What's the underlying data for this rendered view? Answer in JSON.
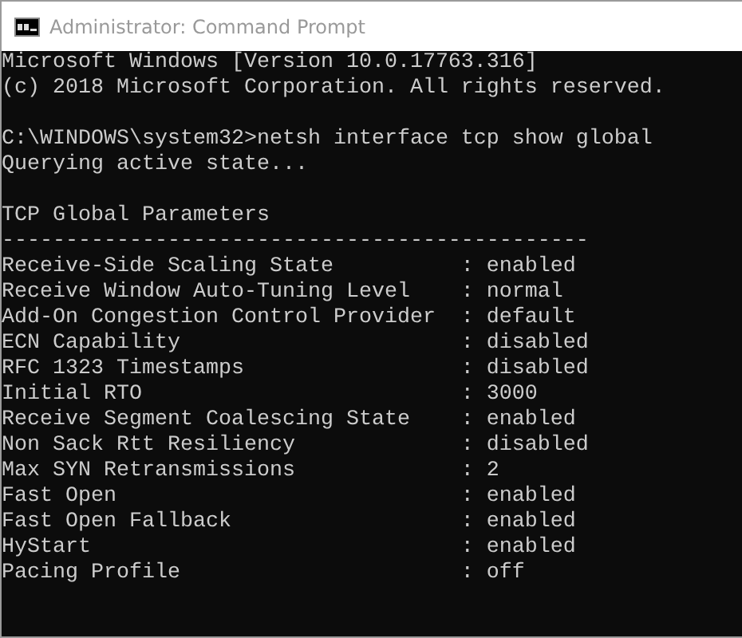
{
  "window": {
    "title": "Administrator: Command Prompt"
  },
  "console": {
    "banner": [
      "Microsoft Windows [Version 10.0.17763.316]",
      "(c) 2018 Microsoft Corporation. All rights reserved."
    ],
    "command": "C:\\WINDOWS\\system32>netsh interface tcp show global",
    "status": "Querying active state...",
    "section_title": "TCP Global Parameters",
    "divider": "----------------------------------------------",
    "parameters": [
      {
        "name": "Receive-Side Scaling State",
        "value": ": enabled"
      },
      {
        "name": "Receive Window Auto-Tuning Level",
        "value": ": normal"
      },
      {
        "name": "Add-On Congestion Control Provider",
        "value": ": default"
      },
      {
        "name": "ECN Capability",
        "value": ": disabled"
      },
      {
        "name": "RFC 1323 Timestamps",
        "value": ": disabled"
      },
      {
        "name": "Initial RTO",
        "value": ": 3000"
      },
      {
        "name": "Receive Segment Coalescing State",
        "value": ": enabled"
      },
      {
        "name": "Non Sack Rtt Resiliency",
        "value": ": disabled"
      },
      {
        "name": "Max SYN Retransmissions",
        "value": ": 2"
      },
      {
        "name": "Fast Open",
        "value": ": enabled"
      },
      {
        "name": "Fast Open Fallback",
        "value": ": enabled"
      },
      {
        "name": "HyStart",
        "value": ": enabled"
      },
      {
        "name": "Pacing Profile",
        "value": ": off"
      }
    ]
  }
}
